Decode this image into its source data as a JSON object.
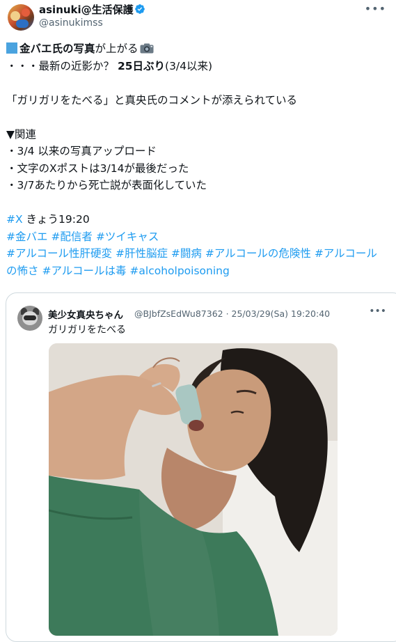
{
  "author": {
    "display_name": "asinuki@生活保護",
    "handle": "@asinukimss",
    "verified": true
  },
  "more_icon": "more-horizontal-icon",
  "post": {
    "line1_bold": "金バエ氏の写真",
    "line1_rest": "が上がる",
    "line2_prefix": "・・・最新の近影か？ ",
    "line2_bold": "25日ぶり",
    "line2_rest": "(3/4以来)",
    "line3": "「ガリガリをたべる」と真央氏のコメントが添えられている",
    "line4": "▼関連",
    "line5": "・3/4 以来の写真アップロード",
    "line6": "・文字のXポストは3/14が最後だった",
    "line7": "・3/7あたりから死亡説が表面化していた",
    "tag_x": "#X",
    "time_text": " きょう19:20",
    "hashtags_line1": [
      "#金バエ",
      "#配信者",
      "#ツイキャス"
    ],
    "hashtags_wrapped": [
      "#アルコール性肝硬変",
      "#肝性脳症",
      "#闘病",
      "#アルコールの危険性",
      "#アルコールの怖さ",
      "#アルコールは毒",
      "#alcoholpoisoning"
    ]
  },
  "quoted": {
    "display_name": "美少女真央ちゃん",
    "meta": "@BJbfZsEdWu87362 · 25/03/29(Sa) 19:20:40",
    "text": "ガリガリをたべる"
  },
  "colors": {
    "link": "#1d9bf0",
    "verified": "#1d9bf0",
    "text": "#0f1419",
    "muted": "#536471"
  }
}
